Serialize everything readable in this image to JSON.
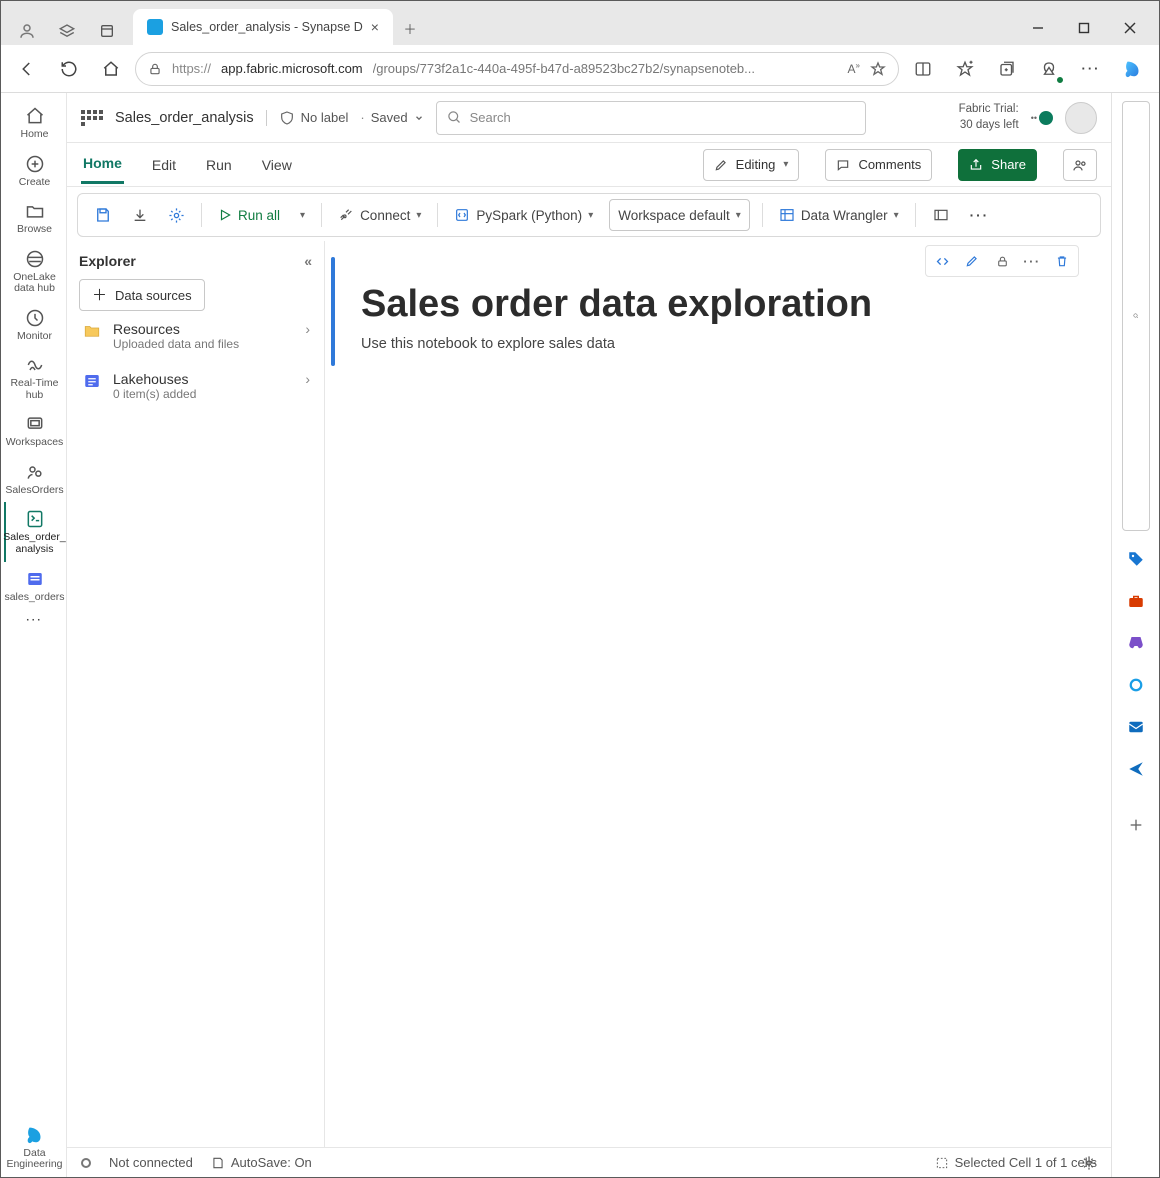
{
  "browser": {
    "tab_title": "Sales_order_analysis - Synapse D",
    "url_host": "app.fabric.microsoft.com",
    "url_path": "/groups/773f2a1c-440a-495f-b47d-a89523bc27b2/synapsenoteb..."
  },
  "header": {
    "doc_name": "Sales_order_analysis",
    "sensitivity": "No label",
    "saved_state": "Saved",
    "search_placeholder": "Search",
    "trial_line1": "Fabric Trial:",
    "trial_line2": "30 days left"
  },
  "left_rail": {
    "items": [
      {
        "label": "Home"
      },
      {
        "label": "Create"
      },
      {
        "label": "Browse"
      },
      {
        "label": "OneLake data hub"
      },
      {
        "label": "Monitor"
      },
      {
        "label": "Real-Time hub"
      },
      {
        "label": "Workspaces"
      },
      {
        "label": "SalesOrders"
      },
      {
        "label": "Sales_order_\nanalysis"
      },
      {
        "label": "sales_orders"
      }
    ],
    "footer_label": "Data Engineering"
  },
  "menubar": {
    "home": "Home",
    "edit": "Edit",
    "run": "Run",
    "view": "View",
    "editing": "Editing",
    "comments": "Comments",
    "share": "Share"
  },
  "toolbar": {
    "run_all": "Run all",
    "connect": "Connect",
    "language": "PySpark (Python)",
    "environment": "Workspace default",
    "data_wrangler": "Data Wrangler"
  },
  "explorer": {
    "title": "Explorer",
    "data_sources_btn": "Data sources",
    "resources_title": "Resources",
    "resources_sub": "Uploaded data and files",
    "lakehouses_title": "Lakehouses",
    "lakehouses_sub": "0 item(s) added"
  },
  "notebook": {
    "cell_title": "Sales order data exploration",
    "cell_text": "Use this notebook to explore sales data"
  },
  "statusbar": {
    "conn": "Not connected",
    "autosave": "AutoSave: On",
    "selection": "Selected Cell 1 of 1 cells"
  }
}
